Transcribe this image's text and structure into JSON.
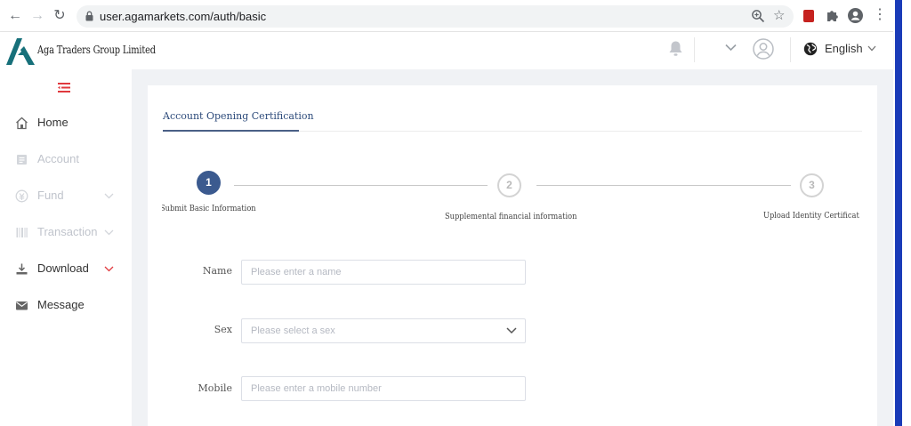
{
  "browser": {
    "url": "user.agamarkets.com/auth/basic"
  },
  "header": {
    "company_name": "Aga Traders Group Limited",
    "language": "English"
  },
  "sidebar": {
    "items": [
      {
        "label": "Home",
        "icon": "home-icon",
        "enabled": true
      },
      {
        "label": "Account",
        "icon": "account-icon",
        "enabled": false
      },
      {
        "label": "Fund",
        "icon": "fund-icon",
        "enabled": false,
        "expandable": true
      },
      {
        "label": "Transaction",
        "icon": "transaction-icon",
        "enabled": false,
        "expandable": true
      },
      {
        "label": "Download",
        "icon": "download-icon",
        "enabled": true,
        "expandable": true
      },
      {
        "label": "Message",
        "icon": "message-icon",
        "enabled": true
      }
    ]
  },
  "main": {
    "tab_label": "Account Opening Certification",
    "steps": [
      {
        "number": "1",
        "label": "Submit Basic Information",
        "status": "active"
      },
      {
        "number": "2",
        "label": "Supplemental financial information",
        "status": "pending"
      },
      {
        "number": "3",
        "label": "Upload Identity Certificat",
        "status": "pending"
      }
    ],
    "form": {
      "name_label": "Name",
      "name_placeholder": "Please enter a name",
      "sex_label": "Sex",
      "sex_placeholder": "Please select a sex",
      "mobile_label": "Mobile",
      "mobile_placeholder": "Please enter a mobile number"
    }
  },
  "colors": {
    "primary": "#3b5a8f",
    "accent_red": "#e0393e",
    "browser_edge": "#1a3bb8"
  }
}
